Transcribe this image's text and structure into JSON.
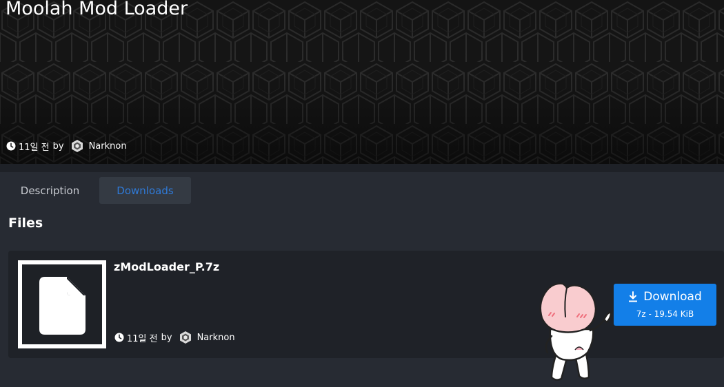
{
  "page": {
    "title": "Moolah Mod Loader",
    "meta": {
      "time": "11일 전",
      "by": "by",
      "author": "Narknon"
    }
  },
  "tabs": [
    {
      "label": "Description",
      "active": false
    },
    {
      "label": "Downloads",
      "active": true
    }
  ],
  "files": {
    "heading": "Files",
    "items": [
      {
        "name": "zModLoader_P.7z",
        "time": "11일 전",
        "by": "by",
        "author": "Narknon",
        "download_label": "Download",
        "download_info": "7z - 19.54 KiB"
      }
    ]
  },
  "colors": {
    "accent": "#137fe8",
    "active_tab_text": "#2f7ad8",
    "background": "#272b33",
    "card": "#1f2228"
  },
  "icons": [
    "clock-icon",
    "author-avatar-icon",
    "file-icon",
    "download-icon",
    "peach-sticker"
  ]
}
